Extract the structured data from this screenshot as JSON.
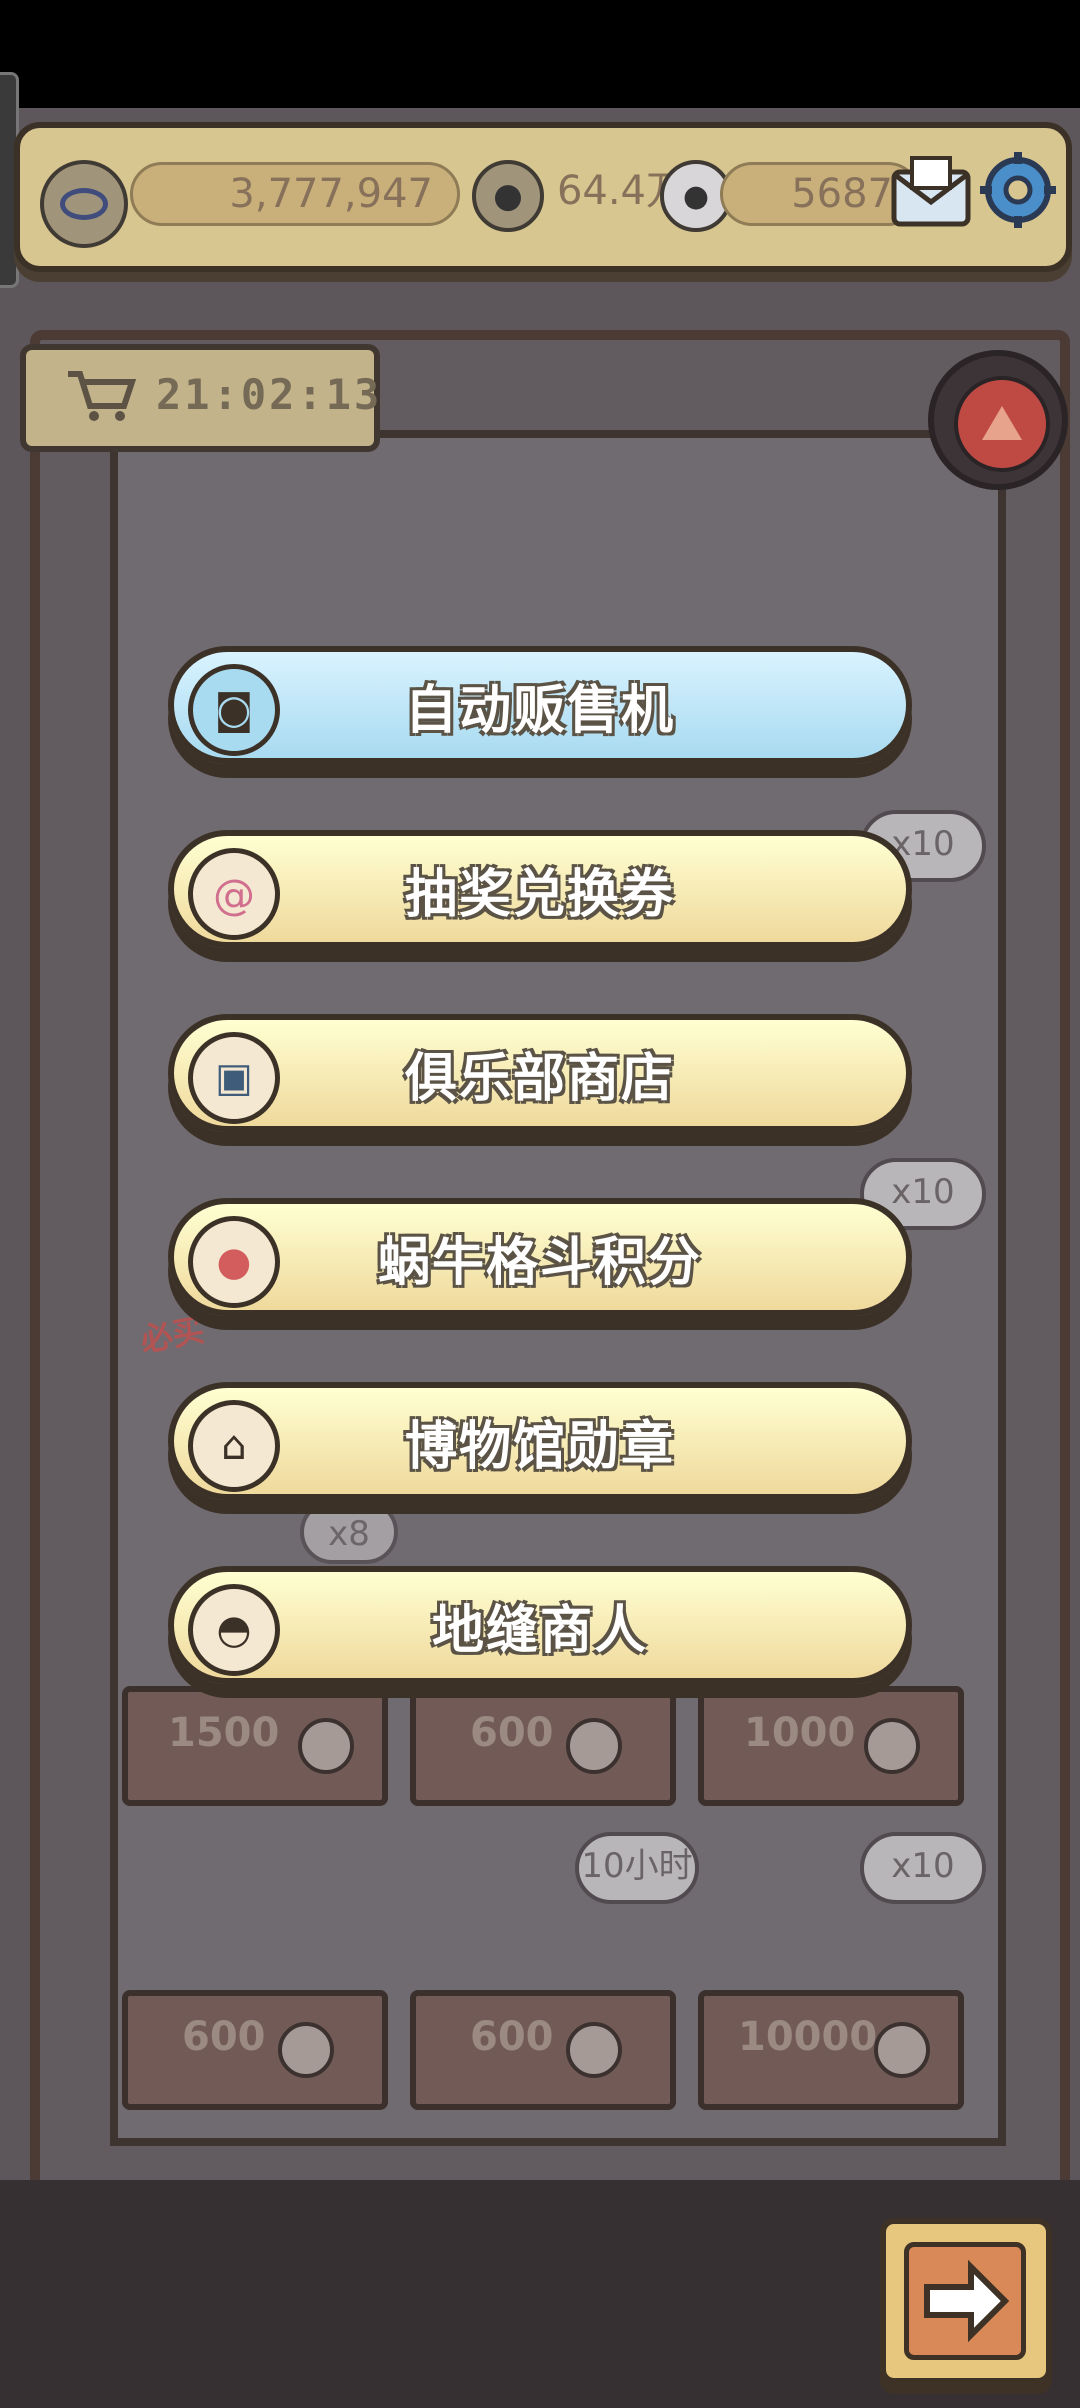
{
  "header": {
    "views": "3,777,947",
    "currency_a": "64.4万",
    "currency_b": "5687"
  },
  "shop": {
    "timer": "21:02:13",
    "bubbles": {
      "row2_right": "x10",
      "row3_right": "x10",
      "row4_left": "x8",
      "row5_mid": "10小时",
      "row5_right": "x10"
    },
    "stamp": "必买",
    "prices_row4": [
      "1500",
      "600",
      "1000"
    ],
    "prices_row5": [
      "600",
      "600",
      "10000"
    ]
  },
  "menu": {
    "items": [
      {
        "label": "自动贩售机",
        "icon": "cat-face-icon",
        "active": true
      },
      {
        "label": "抽奖兑换券",
        "icon": "snail-shell-icon",
        "active": false
      },
      {
        "label": "俱乐部商店",
        "icon": "cash-register-icon",
        "active": false
      },
      {
        "label": "蜗牛格斗积分",
        "icon": "boxing-glove-icon",
        "active": false
      },
      {
        "label": "博物馆勋章",
        "icon": "museum-icon",
        "active": false
      },
      {
        "label": "地缝商人",
        "icon": "helmet-icon",
        "active": false
      }
    ]
  },
  "colors": {
    "button_yellow": "#efd99c",
    "button_blue": "#a8daf0",
    "outline": "#3c3127"
  }
}
